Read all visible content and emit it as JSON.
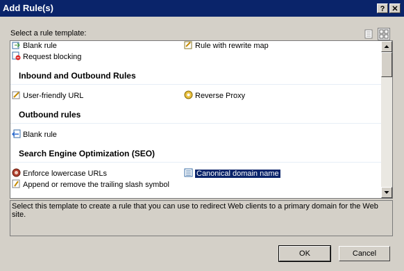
{
  "window": {
    "title": "Add Rule(s)",
    "help_label": "?",
    "close_label": "✕"
  },
  "prompt": "Select a rule template:",
  "view_buttons": [
    {
      "icon": "list-view-icon"
    },
    {
      "icon": "tile-view-icon"
    }
  ],
  "items_top": [
    {
      "label": "Blank rule",
      "icon": "blank-rule-icon"
    },
    {
      "label": "Rule with rewrite map",
      "icon": "rewrite-map-icon"
    },
    {
      "label": "Request blocking",
      "icon": "request-blocking-icon"
    }
  ],
  "groups": [
    {
      "title": "Inbound and Outbound Rules",
      "items": [
        {
          "label": "User-friendly URL",
          "icon": "user-friendly-url-icon"
        },
        {
          "label": "Reverse Proxy",
          "icon": "reverse-proxy-icon"
        }
      ]
    },
    {
      "title": "Outbound rules",
      "items": [
        {
          "label": "Blank rule",
          "icon": "outbound-blank-rule-icon"
        }
      ]
    },
    {
      "title": "Search Engine Optimization (SEO)",
      "items": [
        {
          "label": "Enforce lowercase URLs",
          "icon": "lowercase-url-icon"
        },
        {
          "label": "Canonical domain name",
          "icon": "canonical-domain-icon",
          "selected": true
        },
        {
          "label": "Append or remove the trailing slash symbol",
          "icon": "trailing-slash-icon"
        }
      ]
    }
  ],
  "description": "Select this template to create a rule that you can use to redirect Web clients to a primary domain for the Web site.",
  "buttons": {
    "ok": "OK",
    "cancel": "Cancel"
  },
  "colors": {
    "selection": "#0a246a",
    "titlebar": "#0a246a",
    "face": "#d4d0c8"
  }
}
